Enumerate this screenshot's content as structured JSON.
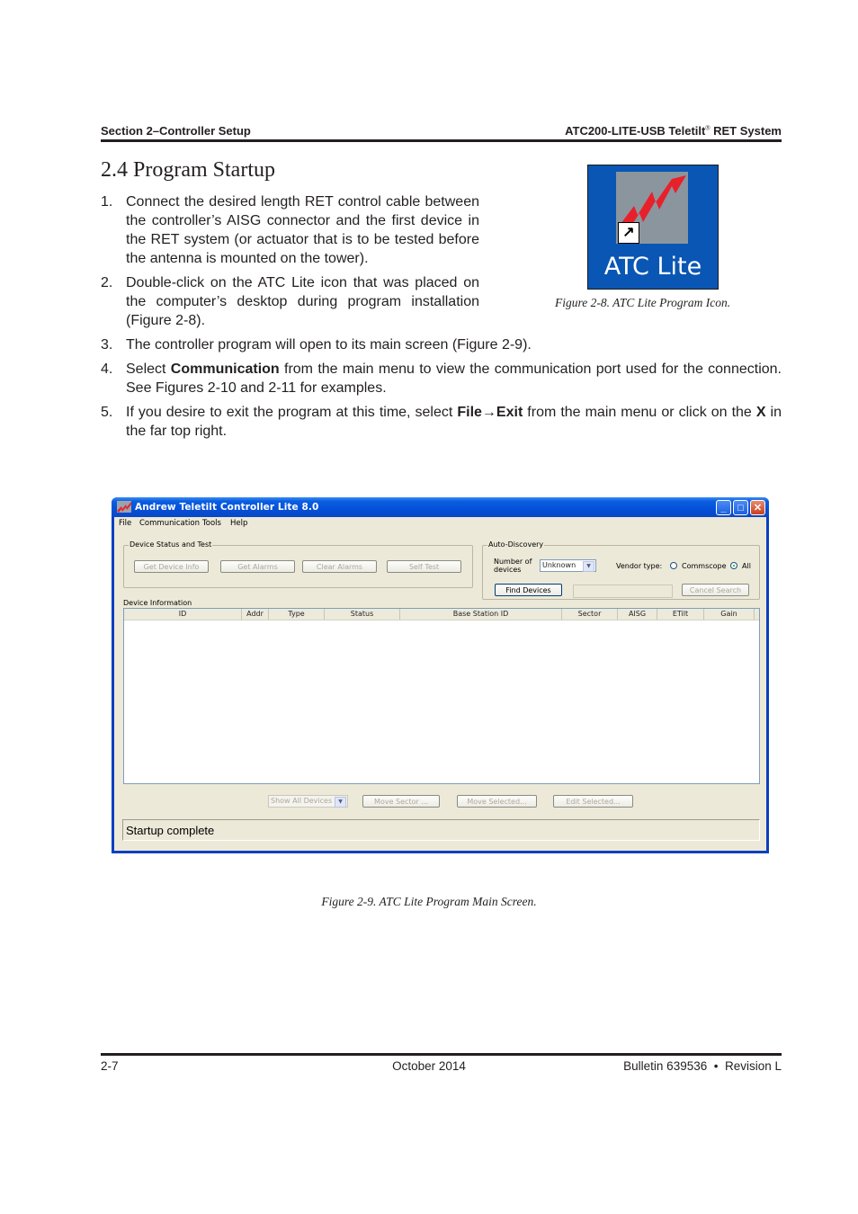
{
  "header": {
    "left": "Section 2–Controller Setup",
    "right_prefix": "ATC200-LITE-USB Teletilt",
    "right_reg": "®",
    "right_suffix": " RET System"
  },
  "section": {
    "title": "2.4 Program Startup"
  },
  "steps": [
    {
      "num": "1.",
      "text": "Connect the desired length RET control cable between the controller’s AISG connector and the first device in the RET system (or actuator that is to be tested before the antenna is mounted on the tower)."
    },
    {
      "num": "2.",
      "text": "Double-click on the ATC Lite icon that was placed on the computer’s desktop during program installation (Figure 2-8)."
    },
    {
      "num": "3.",
      "text": "The controller program will open to its main screen (Figure 2-9)."
    },
    {
      "num": "4.",
      "pre": "Select ",
      "bold": "Communication",
      "post": " from the main menu to view the communication port used for the connection. See Figures 2-10 and 2-11 for examples."
    },
    {
      "num": "5.",
      "pre": "If you desire to exit the program at this time, select ",
      "bold": "File→Exit",
      "mid": " from the main menu or click on the ",
      "bold2": "X",
      "post": " in the far top right."
    }
  ],
  "figure_icon": {
    "label": "ATC Lite",
    "caption": "Figure 2-8. ATC Lite Program Icon.",
    "icon": "lightning-bolt-icon",
    "colors": {
      "background": "#0a56b4",
      "tile": "#8b959e",
      "bolt": "#e8202a"
    }
  },
  "app_window": {
    "title": "Andrew Teletilt Controller Lite 8.0",
    "controls": {
      "minimize": "_",
      "maximize": "□",
      "close": "✕"
    },
    "menu": [
      "File",
      "Communication",
      "Tools",
      "Help"
    ],
    "device_status_group": {
      "label": "Device Status and Test",
      "buttons": [
        "Get Device Info",
        "Get Alarms",
        "Clear Alarms",
        "Self Test"
      ]
    },
    "auto_discovery_group": {
      "label": "Auto-Discovery",
      "number_label_line1": "Number of",
      "number_label_line2": "devices",
      "number_value": "Unknown",
      "vendor_label": "Vendor type:",
      "vendor_options": [
        {
          "label": "Commscope",
          "selected": false
        },
        {
          "label": "All",
          "selected": true
        }
      ],
      "find_button": "Find Devices",
      "search_field_value": "",
      "cancel_button": "Cancel Search"
    },
    "device_info": {
      "label": "Device Information",
      "columns": [
        "ID",
        "Addr",
        "Type",
        "Status",
        "Base Station ID",
        "Sector",
        "AISG",
        "ETilt",
        "Gain"
      ],
      "rows": []
    },
    "bottom_controls": {
      "filter_value": "Show All Devices",
      "buttons": [
        "Move Sector ...",
        "Move Selected...",
        "Edit Selected..."
      ]
    },
    "status_text": "Startup complete"
  },
  "figure_main": {
    "caption": "Figure 2-9. ATC Lite Program Main Screen."
  },
  "footer": {
    "page": "2-7",
    "date": "October 2014",
    "bulletin": "Bulletin 639536  •  Revision L"
  }
}
